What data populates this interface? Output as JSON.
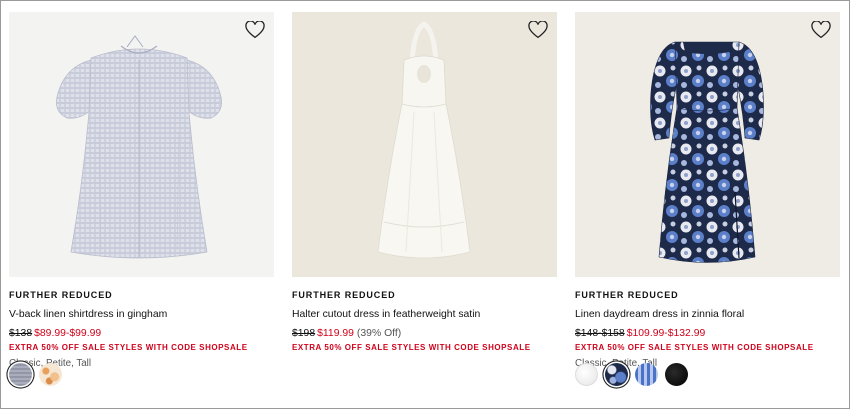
{
  "products": [
    {
      "badge": "FURTHER REDUCED",
      "name": "V-back linen shirtdress in gingham",
      "orig_price": "$138",
      "sale_price": "$89.99-$99.99",
      "discount": "",
      "promo": "EXTRA 50% OFF SALE STYLES WITH CODE SHOPSALE",
      "fits": "Classic, Petite, Tall",
      "image_bg": "#f3f3f1",
      "favorite_icon": "heart-outline-icon",
      "swatches": [
        "gray-gingham",
        "peach-floral"
      ]
    },
    {
      "badge": "FURTHER REDUCED",
      "name": "Halter cutout dress in featherweight satin",
      "orig_price": "$198",
      "sale_price": "$119.99",
      "discount": "(39% Off)",
      "promo": "EXTRA 50% OFF SALE STYLES WITH CODE SHOPSALE",
      "fits": "",
      "image_bg": "#ece7dc",
      "favorite_icon": "heart-outline-icon",
      "swatches": []
    },
    {
      "badge": "FURTHER REDUCED",
      "name": "Linen daydream dress in zinnia floral",
      "orig_price": "$148-$158",
      "sale_price": "$109.99-$132.99",
      "discount": "",
      "promo": "EXTRA 50% OFF SALE STYLES WITH CODE SHOPSALE",
      "fits": "Classic, Petite, Tall",
      "image_bg": "#efece6",
      "favorite_icon": "heart-outline-icon",
      "swatches": [
        "white",
        "blue-floral",
        "blue-stripe",
        "black"
      ]
    }
  ],
  "colors": {
    "sale_red": "#d0021b",
    "text": "#111111",
    "muted": "#555555"
  }
}
